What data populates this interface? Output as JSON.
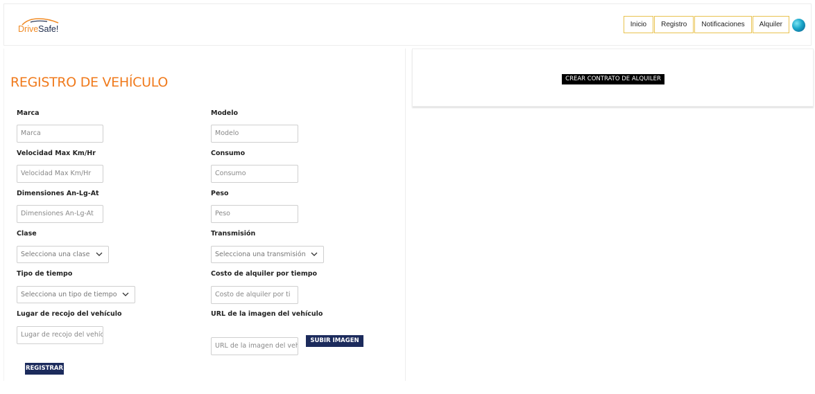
{
  "brand": {
    "part1": "Drive",
    "part2": "Safe!"
  },
  "nav": [
    {
      "label": "Inicio"
    },
    {
      "label": "Registro"
    },
    {
      "label": "Notificaciones"
    },
    {
      "label": "Alquiler"
    }
  ],
  "form": {
    "title": "REGISTRO DE VEHÍCULO",
    "marca": {
      "label": "Marca",
      "placeholder": "Marca"
    },
    "modelo": {
      "label": "Modelo",
      "placeholder": "Modelo"
    },
    "velocidad": {
      "label": "Velocidad Max Km/Hr",
      "placeholder": "Velocidad Max Km/Hr"
    },
    "consumo": {
      "label": "Consumo",
      "placeholder": "Consumo"
    },
    "dimensiones": {
      "label": "Dimensiones An-Lg-At",
      "placeholder": "Dimensiones An-Lg-At"
    },
    "peso": {
      "label": "Peso",
      "placeholder": "Peso"
    },
    "clase": {
      "label": "Clase",
      "selected": "Selecciona una clase"
    },
    "transmision": {
      "label": "Transmisión",
      "selected": "Selecciona una transmisión"
    },
    "tipo_tiempo": {
      "label": "Tipo de tiempo",
      "selected": "Selecciona un tipo de tiempo"
    },
    "costo": {
      "label": "Costo de alquiler por tiempo",
      "placeholder": "Costo de alquiler por ti"
    },
    "lugar": {
      "label": "Lugar de recojo del vehículo",
      "placeholder": "Lugar de recojo del vehíc"
    },
    "url_imagen": {
      "label": "URL de la imagen del vehículo",
      "placeholder": "URL de la imagen del veh"
    },
    "subir_label": "SUBIR IMAGEN",
    "registrar_label": "REGISTRAR"
  },
  "contract": {
    "button_label": "CREAR CONTRATO DE ALQUILER"
  },
  "colors": {
    "accent": "#f07a1c",
    "nav_border": "#e9c24e",
    "button_dark": "#1c2b5c"
  }
}
